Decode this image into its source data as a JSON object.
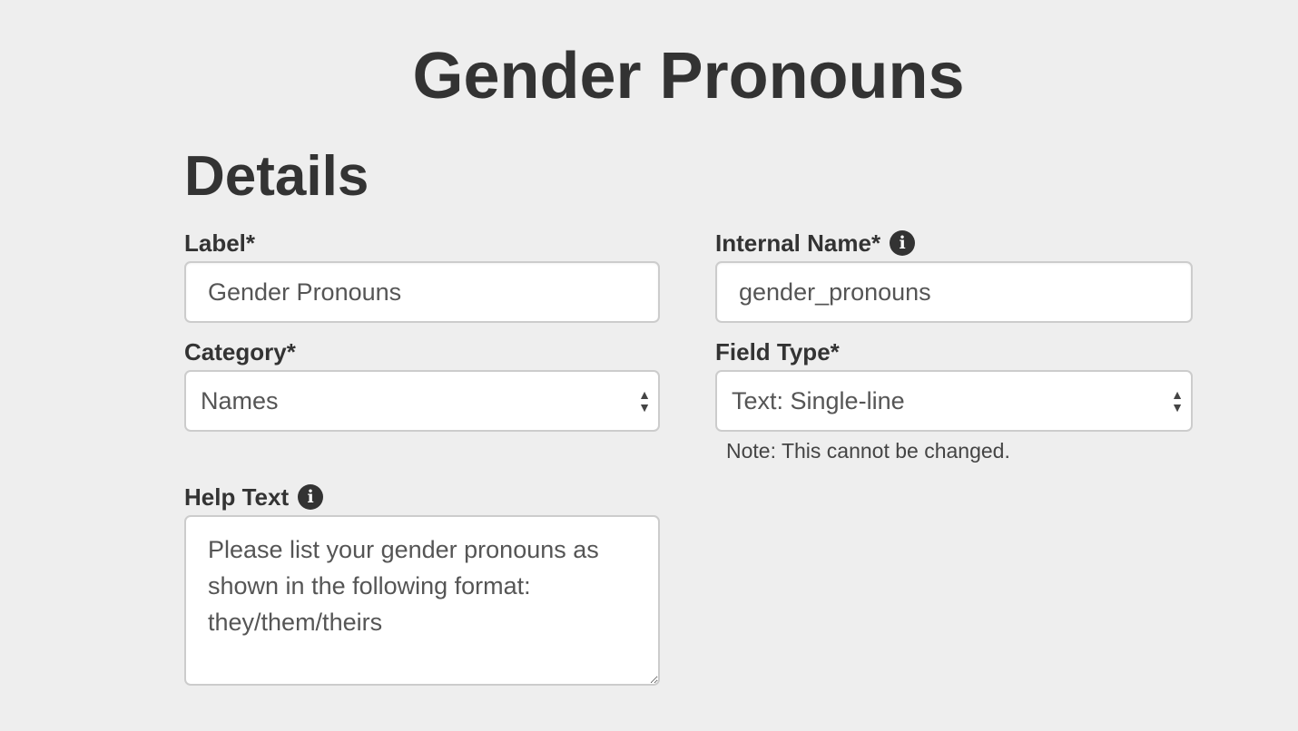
{
  "page": {
    "title": "Gender Pronouns"
  },
  "details": {
    "heading": "Details",
    "label": {
      "label": "Label*",
      "value": "Gender Pronouns"
    },
    "internal_name": {
      "label": "Internal Name*",
      "value": "gender_pronouns",
      "info_icon": "info-icon"
    },
    "category": {
      "label": "Category*",
      "selected": "Names"
    },
    "field_type": {
      "label": "Field Type*",
      "selected": "Text: Single-line",
      "note": "Note: This cannot be changed."
    },
    "help_text": {
      "label": "Help Text",
      "value": "Please list your gender pronouns as shown in the following format: they/them/theirs",
      "info_icon": "info-icon"
    }
  },
  "colors": {
    "background": "#eeeeee",
    "text": "#333333",
    "input_border": "#cccccc"
  }
}
